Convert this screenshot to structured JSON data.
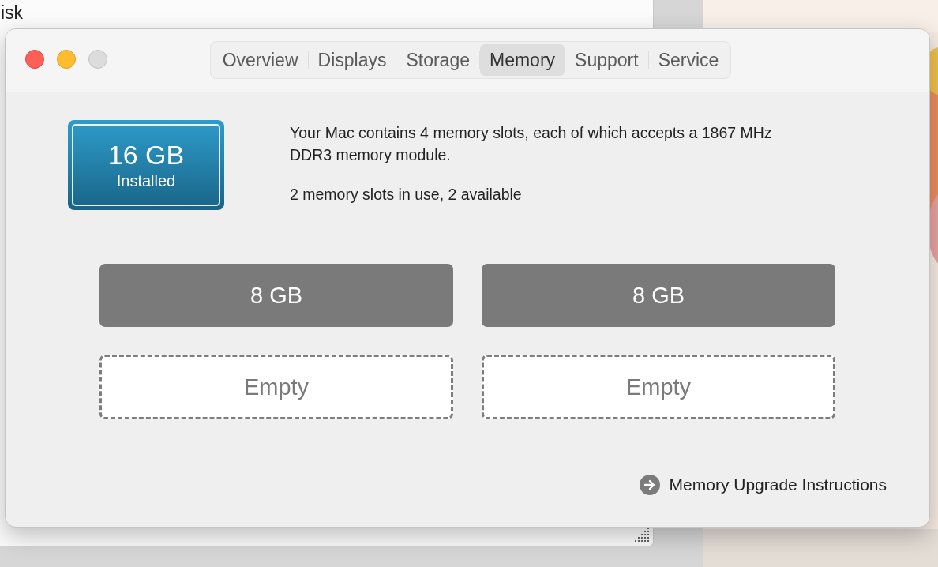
{
  "background_window": {
    "title": "isk"
  },
  "window": {
    "tabs": [
      {
        "label": "Overview",
        "selected": false
      },
      {
        "label": "Displays",
        "selected": false
      },
      {
        "label": "Storage",
        "selected": false
      },
      {
        "label": "Memory",
        "selected": true
      },
      {
        "label": "Support",
        "selected": false
      },
      {
        "label": "Service",
        "selected": false
      }
    ]
  },
  "memory": {
    "total": "16 GB",
    "total_caption": "Installed",
    "description": "Your Mac contains 4 memory slots, each of which accepts a 1867 MHz DDR3 memory module.",
    "usage": "2 memory slots in use, 2 available",
    "slots": [
      {
        "kind": "installed",
        "label": "8 GB"
      },
      {
        "kind": "installed",
        "label": "8 GB"
      },
      {
        "kind": "empty",
        "label": "Empty"
      },
      {
        "kind": "empty",
        "label": "Empty"
      }
    ],
    "link": "Memory Upgrade Instructions"
  }
}
